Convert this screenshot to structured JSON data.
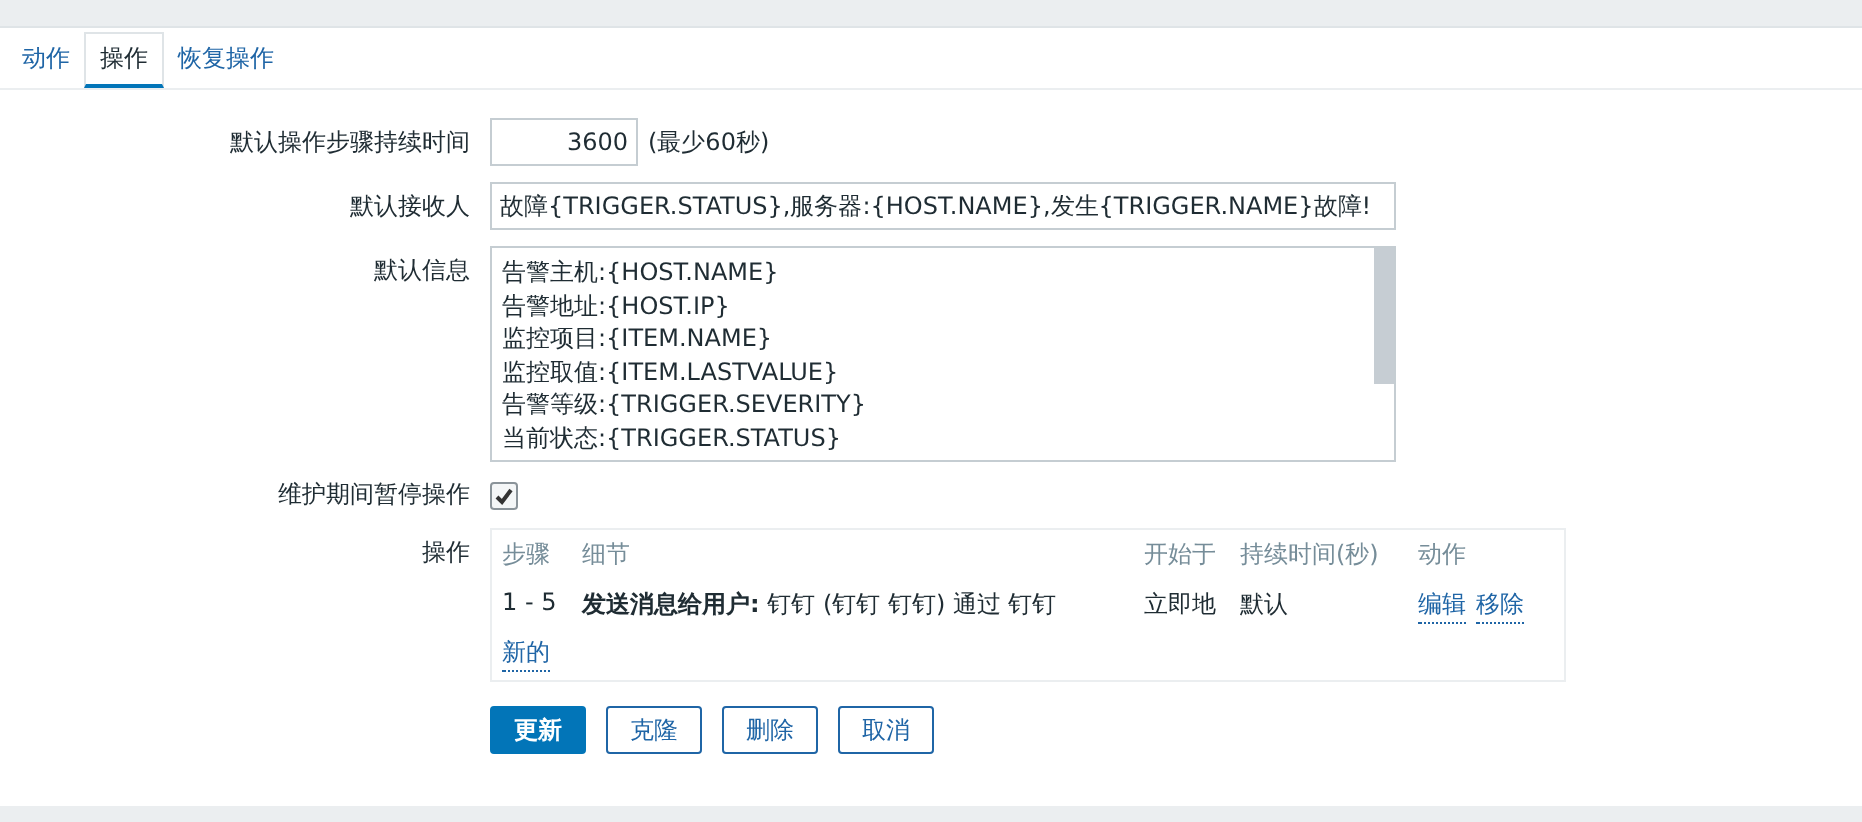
{
  "tabs": [
    {
      "label": "动作",
      "selected": false
    },
    {
      "label": "操作",
      "selected": true
    },
    {
      "label": "恢复操作",
      "selected": false
    }
  ],
  "form": {
    "step_duration": {
      "label": "默认操作步骤持续时间",
      "value": "3600",
      "hint": "(最少60秒)"
    },
    "recipient": {
      "label": "默认接收人",
      "value": "故障{TRIGGER.STATUS},服务器:{HOST.NAME},发生{TRIGGER.NAME}故障!"
    },
    "message": {
      "label": "默认信息",
      "lines": [
        "告警主机:{HOST.NAME}",
        "告警地址:{HOST.IP}",
        "监控项目:{ITEM.NAME}",
        "监控取值:{ITEM.LASTVALUE}",
        "告警等级:{TRIGGER.SEVERITY}",
        "当前状态:{TRIGGER.STATUS}"
      ]
    },
    "pause": {
      "label": "维护期间暂停操作",
      "checked": true
    },
    "operations": {
      "label": "操作",
      "columns": [
        "步骤",
        "细节",
        "开始于",
        "持续时间(秒)",
        "动作"
      ],
      "rows": [
        {
          "steps": "1 - 5",
          "detail": "**发送消息给用户:** 钉钉 (钉钉 钉钉) 通过 钉钉",
          "start": "立即地",
          "duration": "默认",
          "actions": [
            "编辑",
            "移除"
          ]
        }
      ],
      "new_link": "新的"
    }
  },
  "buttons": [
    {
      "label": "更新",
      "kind": "primary"
    },
    {
      "label": "克隆",
      "kind": "secondary"
    },
    {
      "label": "删除",
      "kind": "secondary"
    },
    {
      "label": "取消",
      "kind": "secondary"
    }
  ]
}
